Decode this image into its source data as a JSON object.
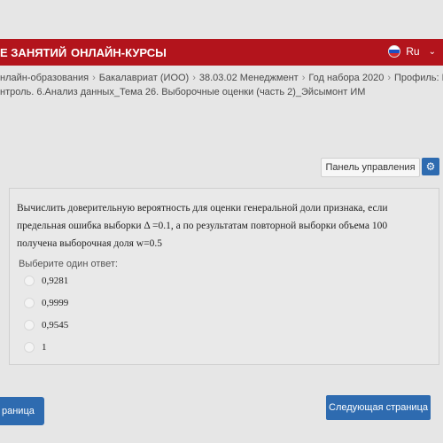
{
  "navbar": {
    "item_schedule": "Е ЗАНЯТИЙ",
    "item_online_courses": "ОНЛАЙН-КУРСЫ",
    "language": "Ru",
    "accent_color": "#b3141c"
  },
  "breadcrumb": {
    "line1": [
      "нлайн-образования",
      "Бакалавриат (ИОО)",
      "38.03.02 Менеджмент",
      "Год набора 2020",
      "Профиль: Маркетинг"
    ],
    "line2": "нтроль. 6.Анализ данных_Тема 26. Выборочные оценки (часть 2)_Эйсымонт ИМ"
  },
  "control_panel": {
    "label": "Панель управления",
    "icon": "gear-icon"
  },
  "question": {
    "text": "Вычислить доверительную вероятность для оценки генеральной доли признака, если предельная ошибка выборки  Δ =0.1, а по результатам повторной выборки объема 100 получена  выборочная доля  w=0.5",
    "prompt": "Выберите один ответ:",
    "options": [
      "0,9281",
      "0,9999",
      "0,9545",
      "1"
    ]
  },
  "footer": {
    "prev_label": "раница",
    "next_label": "Следующая страница",
    "button_color": "#2e6bb0"
  }
}
